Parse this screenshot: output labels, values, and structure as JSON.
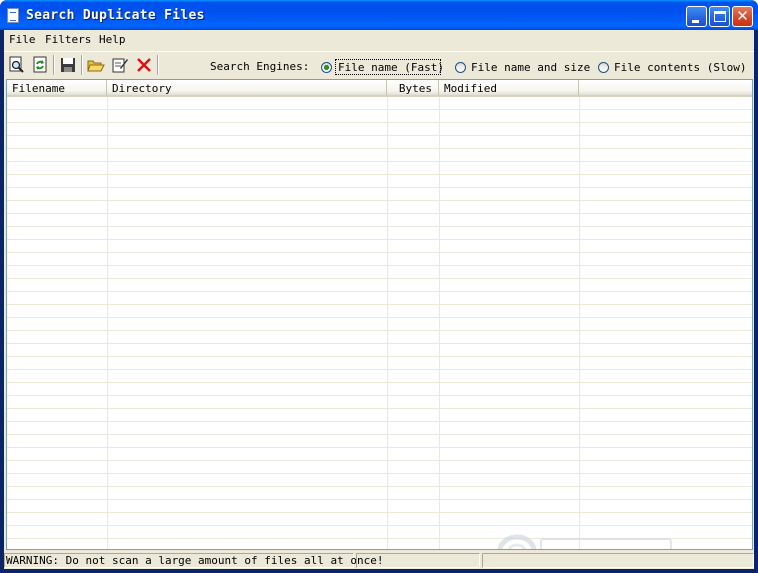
{
  "window": {
    "title": "Search Duplicate Files"
  },
  "menu": {
    "items": [
      "File",
      "Filters",
      "Help"
    ]
  },
  "toolbar": {
    "tools": [
      "search-preview-icon",
      "refresh-icon",
      "save-icon",
      "open-folder-icon",
      "edit-icon",
      "delete-icon"
    ],
    "search_engines_label": "Search Engines:",
    "engines": [
      {
        "label": "File name (Fast)",
        "selected": true
      },
      {
        "label": "File name and size",
        "selected": false
      },
      {
        "label": "File contents (Slow)",
        "selected": false
      }
    ]
  },
  "list": {
    "columns": [
      "Filename",
      "Directory",
      "Bytes",
      "Modified"
    ],
    "rows": []
  },
  "status": {
    "message": "WARNING: Do not scan a large amount of files all at once!",
    "panel2": "",
    "panel3": ""
  },
  "colors": {
    "titlebar": "#0054e3",
    "face": "#ece9d8",
    "close_button": "#d84425"
  }
}
